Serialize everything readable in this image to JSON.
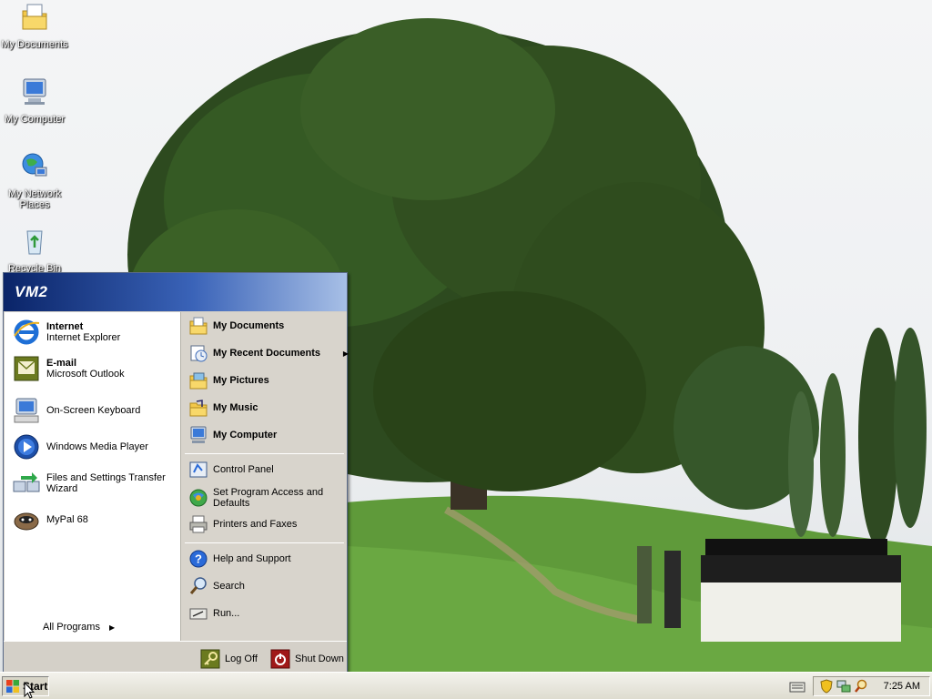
{
  "desktop_icons": [
    {
      "label": "My Documents",
      "icon": "my-documents-icon"
    },
    {
      "label": "My Computer",
      "icon": "my-computer-icon"
    },
    {
      "label": "My Network Places",
      "icon": "network-places-icon"
    },
    {
      "label": "Recycle Bin",
      "icon": "recycle-bin-icon"
    }
  ],
  "start_menu": {
    "user": "VM2",
    "pinned": [
      {
        "title": "Internet",
        "subtitle": "Internet Explorer",
        "icon": "internet-explorer-icon"
      },
      {
        "title": "E-mail",
        "subtitle": "Microsoft Outlook",
        "icon": "outlook-icon"
      }
    ],
    "recent": [
      {
        "label": "On-Screen Keyboard",
        "icon": "on-screen-keyboard-icon"
      },
      {
        "label": "Windows Media Player",
        "icon": "media-player-icon"
      },
      {
        "label": "Files and Settings Transfer Wizard",
        "icon": "transfer-wizard-icon"
      },
      {
        "label": "MyPal 68",
        "icon": "mypal-icon"
      }
    ],
    "all_programs": "All Programs",
    "places": [
      {
        "label": "My Documents",
        "icon": "my-documents-icon"
      },
      {
        "label": "My Recent Documents",
        "icon": "recent-documents-icon"
      },
      {
        "label": "My Pictures",
        "icon": "my-pictures-icon"
      },
      {
        "label": "My Music",
        "icon": "my-music-icon"
      },
      {
        "label": "My Computer",
        "icon": "my-computer-icon"
      }
    ],
    "settings": [
      {
        "label": "Control Panel",
        "icon": "control-panel-icon"
      },
      {
        "label": "Set Program Access and Defaults",
        "icon": "program-access-icon"
      },
      {
        "label": "Printers and Faxes",
        "icon": "printers-icon"
      }
    ],
    "help": [
      {
        "label": "Help and Support",
        "icon": "help-icon"
      },
      {
        "label": "Search",
        "icon": "search-icon"
      },
      {
        "label": "Run...",
        "icon": "run-icon"
      }
    ],
    "logoff": "Log Off",
    "shutdown": "Shut Down"
  },
  "taskbar": {
    "start_label": "Start",
    "clock": "7:25 AM"
  }
}
